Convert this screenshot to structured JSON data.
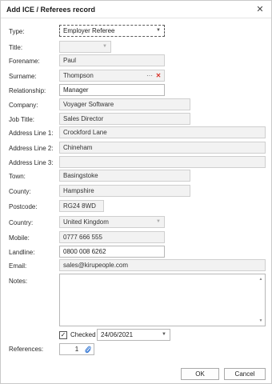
{
  "window": {
    "title": "Add ICE / Referees record",
    "close_glyph": "✕"
  },
  "type": {
    "label": "Type:",
    "value": "Employer Referee"
  },
  "title_field": {
    "label": "Title:",
    "value": ""
  },
  "forename": {
    "label": "Forename:",
    "value": "Paul"
  },
  "surname": {
    "label": "Surname:",
    "value": "Thompson",
    "more_glyph": "···",
    "clear_glyph": "✕"
  },
  "relationship": {
    "label": "Relationship:",
    "value": "Manager"
  },
  "company": {
    "label": "Company:",
    "value": "Voyager Software"
  },
  "job_title": {
    "label": "Job Title:",
    "value": "Sales Director"
  },
  "address1": {
    "label": "Address Line 1:",
    "value": "Crockford Lane"
  },
  "address2": {
    "label": "Address Line 2:",
    "value": "Chineham"
  },
  "address3": {
    "label": "Address Line 3:",
    "value": ""
  },
  "town": {
    "label": "Town:",
    "value": "Basingstoke"
  },
  "county": {
    "label": "County:",
    "value": "Hampshire"
  },
  "postcode": {
    "label": "Postcode:",
    "value": "RG24 8WD"
  },
  "country": {
    "label": "Country:",
    "value": "United Kingdom"
  },
  "mobile": {
    "label": "Mobile:",
    "value": "0777 666 555"
  },
  "landline": {
    "label": "Landline:",
    "value": "0800 008 6262"
  },
  "email": {
    "label": "Email:",
    "value": "sales@kirupeople.com"
  },
  "notes": {
    "label": "Notes:",
    "value": ""
  },
  "checked": {
    "label": "Checked",
    "is_checked": true,
    "check_glyph": "✓",
    "date": "24/06/2021"
  },
  "references": {
    "label": "References:",
    "count": "1",
    "icon": "paperclip-icon"
  },
  "buttons": {
    "ok": "OK",
    "cancel": "Cancel"
  },
  "colors": {
    "accent_red": "#d9342b",
    "clip_blue": "#3a7bd5"
  }
}
